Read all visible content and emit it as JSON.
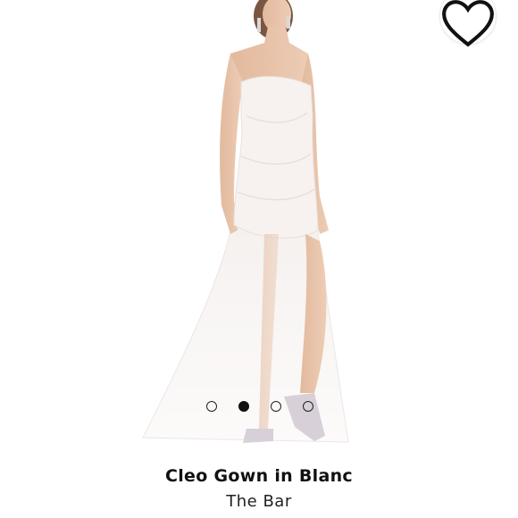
{
  "product": {
    "name": "Cleo Gown in Blanc",
    "brand": "The Bar"
  },
  "carousel": {
    "total": 4,
    "active_index": 1
  },
  "favorite": {
    "icon": "heart-outline-icon",
    "selected": false
  },
  "colors": {
    "background": "#ffffff",
    "text": "#111111",
    "dot": "#111111",
    "dress": "#f7f2f0",
    "skin": "#e6c1a6"
  }
}
